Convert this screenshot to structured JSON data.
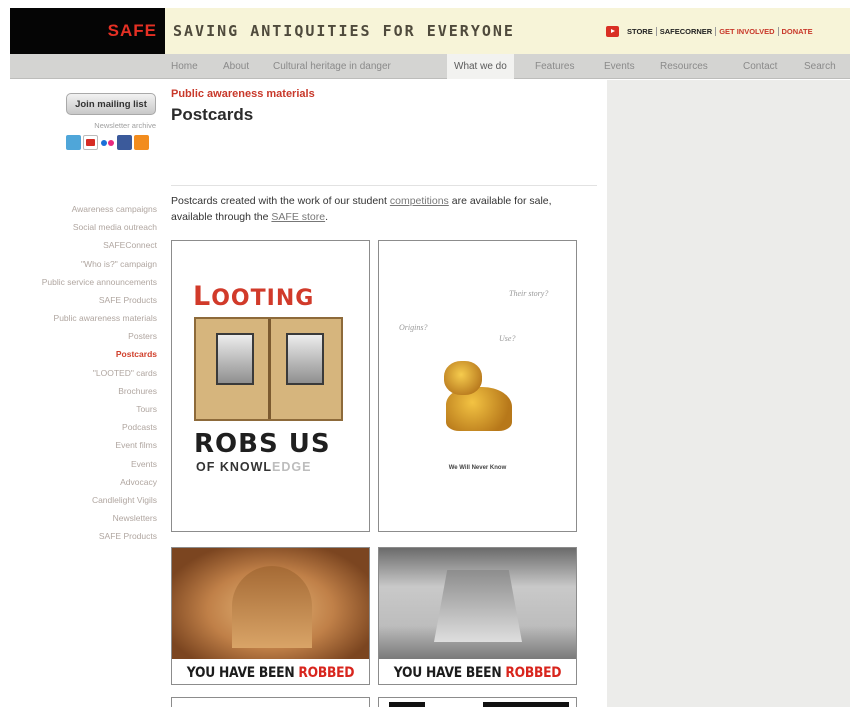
{
  "header": {
    "logo": "SAFE",
    "tagline": "SAVING ANTIQUITIES FOR EVERYONE",
    "top_links": [
      "STORE",
      "SAFECORNER",
      "GET INVOLVED",
      "DONATE"
    ]
  },
  "nav": {
    "items": [
      "Home",
      "About",
      "Cultural heritage in danger",
      "What we do",
      "Features",
      "Events",
      "Resources",
      "Contact",
      "Search"
    ],
    "active": "What we do"
  },
  "sidebar": {
    "join_button": "Join mailing list",
    "newsletter_link": "Newsletter archive",
    "social_icons": [
      "twitter-icon",
      "youtube-icon",
      "flickr-icon",
      "facebook-icon",
      "rss-icon"
    ],
    "items": [
      "Awareness campaigns",
      "Social media outreach",
      "SAFEConnect",
      "\"Who is?\" campaign",
      "Public service announcements",
      "SAFE Products",
      "Public awareness materials",
      "Posters",
      "Postcards",
      "\"LOOTED\" cards",
      "Brochures",
      "Tours",
      "Podcasts",
      "Event films",
      "Events",
      "Advocacy",
      "Candlelight Vigils",
      "Newsletters",
      "SAFE Products"
    ],
    "active": "Postcards"
  },
  "main": {
    "breadcrumb": "Public awareness materials",
    "title": "Postcards",
    "intro_before": "Postcards created with the work of our student ",
    "intro_link1": "competitions",
    "intro_middle": " are available for sale, available through the ",
    "intro_link2": "SAFE store",
    "intro_after": "."
  },
  "postcards": {
    "card1": {
      "title_first": "L",
      "title_rest": "OOTING",
      "line2": "ROBS US",
      "line3_dark": "OF KNOWL",
      "line3_fade": "EDGE"
    },
    "card2": {
      "words": [
        "Their story?",
        "Origins?",
        "Use?"
      ],
      "caption": "We Will Never Know"
    },
    "card3": {
      "text_black": "YOU HAVE BEEN ",
      "text_red": "ROBBED"
    },
    "card4": {
      "text_black": "YOU HAVE BEEN ",
      "text_red": "ROBBED"
    }
  },
  "colors": {
    "brand_red": "#e53024",
    "active_link": "#d0402c",
    "header_bg": "#f7f4d8",
    "nav_bg": "#d4d4d2",
    "panel_bg": "#ececea"
  }
}
